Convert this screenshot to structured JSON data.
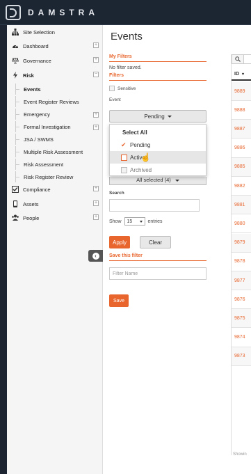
{
  "app": {
    "brand": "DAMSTRA"
  },
  "sidebar": {
    "items": [
      {
        "label": "Site Selection",
        "icon": "sitemap-icon"
      },
      {
        "label": "Dashboard",
        "icon": "dashboard-icon"
      },
      {
        "label": "Governance",
        "icon": "scale-icon"
      },
      {
        "label": "Risk",
        "icon": "lightning-icon"
      }
    ],
    "risk_sub": [
      {
        "label": "Events"
      },
      {
        "label": "Event Register Reviews"
      },
      {
        "label": "Emergency"
      },
      {
        "label": "Formal Investigation"
      },
      {
        "label": "JSA / SWMS"
      },
      {
        "label": "Multiple Risk Assessment"
      },
      {
        "label": "Risk Assessment"
      },
      {
        "label": "Risk Register Review"
      }
    ],
    "bottom_items": [
      {
        "label": "Compliance",
        "icon": "checkbox-icon"
      },
      {
        "label": "Assets",
        "icon": "device-icon"
      },
      {
        "label": "People",
        "icon": "people-icon"
      }
    ],
    "plus": "+",
    "minus": "−",
    "collapse_glyph": "‹"
  },
  "main": {
    "title": "Events",
    "filters": {
      "my_filters_heading": "My Filters",
      "no_filter_text": "No filter saved.",
      "filters_heading": "Filters",
      "sensitive_label": "Sensitive",
      "event_label": "Event",
      "event_selected": "Pending",
      "dropdown": {
        "select_all": "Select All",
        "options": [
          {
            "label": "Pending",
            "checked": true
          },
          {
            "label": "Active",
            "checked": false
          },
          {
            "label": "Archived",
            "checked": false
          }
        ]
      },
      "all_selected": "All selected (4)",
      "search_label": "Search",
      "show_prefix": "Show",
      "show_value": "15",
      "show_suffix": "entries",
      "apply_label": "Apply",
      "clear_label": "Clear",
      "save_filter_heading": "Save this filter",
      "filter_name_placeholder": "Filter Name",
      "save_label": "Save"
    }
  },
  "table": {
    "search_glyph": "🔍",
    "id_header": "ID",
    "rows": [
      "9889",
      "9888",
      "9887",
      "9886",
      "9885",
      "9882",
      "9881",
      "9880",
      "9879",
      "9878",
      "9877",
      "9876",
      "9875",
      "9874",
      "9873"
    ],
    "showing_text": "Showin"
  },
  "colors": {
    "accent": "#e8662e",
    "topbar": "#1c2532"
  }
}
